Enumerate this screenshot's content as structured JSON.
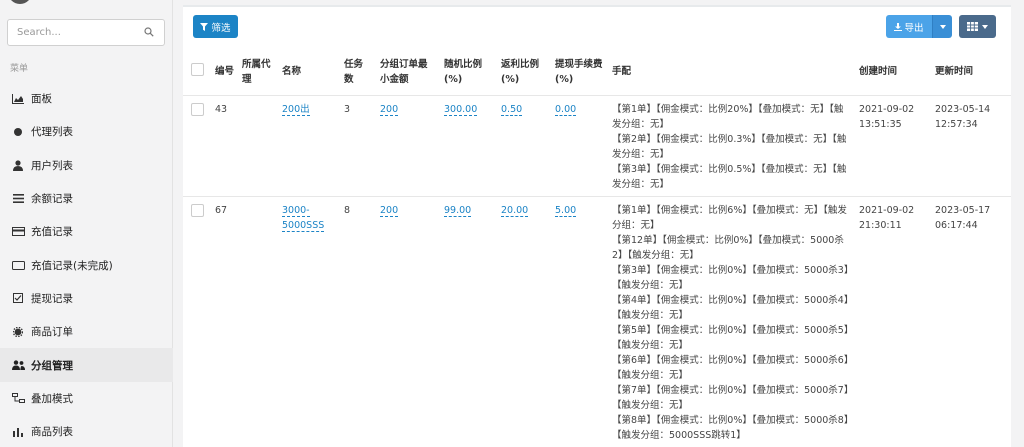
{
  "sidebar": {
    "search_placeholder": "Search...",
    "menu_heading": "菜单",
    "items": [
      {
        "label": "面板",
        "icon": "chart-area-icon"
      },
      {
        "label": "代理列表",
        "icon": "circle-icon"
      },
      {
        "label": "用户列表",
        "icon": "user-icon"
      },
      {
        "label": "余额记录",
        "icon": "list-icon"
      },
      {
        "label": "充值记录",
        "icon": "card-icon"
      },
      {
        "label": "充值记录(未完成)",
        "icon": "rect-outline-icon"
      },
      {
        "label": "提现记录",
        "icon": "check-square-icon"
      },
      {
        "label": "商品订单",
        "icon": "gear-icon"
      },
      {
        "label": "分组管理",
        "icon": "users-icon"
      },
      {
        "label": "叠加模式",
        "icon": "sitemap-icon"
      },
      {
        "label": "商品列表",
        "icon": "bars-icon"
      }
    ],
    "active_index": 8
  },
  "toolbar": {
    "filter_label": "筛选",
    "export_label": "导出"
  },
  "table": {
    "headers": [
      "编号",
      "所属代理",
      "名称",
      "任务数",
      "分组订单最小金额",
      "随机比例(%)",
      "返利比例(%)",
      "提现手续费(%)",
      "手配",
      "创建时间",
      "更新时间"
    ],
    "rows": [
      {
        "id": "43",
        "agent": "",
        "name": "200出",
        "tasks": "3",
        "min_amount": "200",
        "random_ratio": "300.00",
        "rebate_ratio": "0.50",
        "fee": "0.00",
        "config": [
          "【第1单】【佣金模式：比例20%】【叠加模式：无】【触发分组：无】",
          "【第2单】【佣金模式：比例0.3%】【叠加模式：无】【触发分组：无】",
          "【第3单】【佣金模式：比例0.5%】【叠加模式：无】【触发分组：无】"
        ],
        "created": "2021-09-02 13:51:35",
        "updated": "2023-05-14 12:57:34"
      },
      {
        "id": "67",
        "agent": "",
        "name": "3000-5000SSS",
        "tasks": "8",
        "min_amount": "200",
        "random_ratio": "99.00",
        "rebate_ratio": "20.00",
        "fee": "5.00",
        "config": [
          "【第1单】【佣金模式：比例6%】【叠加模式：无】【触发分组：无】",
          "【第12单】【佣金模式：比例0%】【叠加模式：5000杀2】【触发分组：无】",
          "【第3单】【佣金模式：比例0%】【叠加模式：5000杀3】【触发分组：无】",
          "【第4单】【佣金模式：比例0%】【叠加模式：5000杀4】【触发分组：无】",
          "【第5单】【佣金模式：比例0%】【叠加模式：5000杀5】【触发分组：无】",
          "【第6单】【佣金模式：比例0%】【叠加模式：5000杀6】【触发分组：无】",
          "【第7单】【佣金模式：比例0%】【叠加模式：5000杀7】【触发分组：无】",
          "【第8单】【佣金模式：比例0%】【叠加模式：5000杀8】【触发分组：5000SSS跳转1】"
        ],
        "created": "2021-09-02 21:30:11",
        "updated": "2023-05-17 06:17:44"
      }
    ]
  }
}
